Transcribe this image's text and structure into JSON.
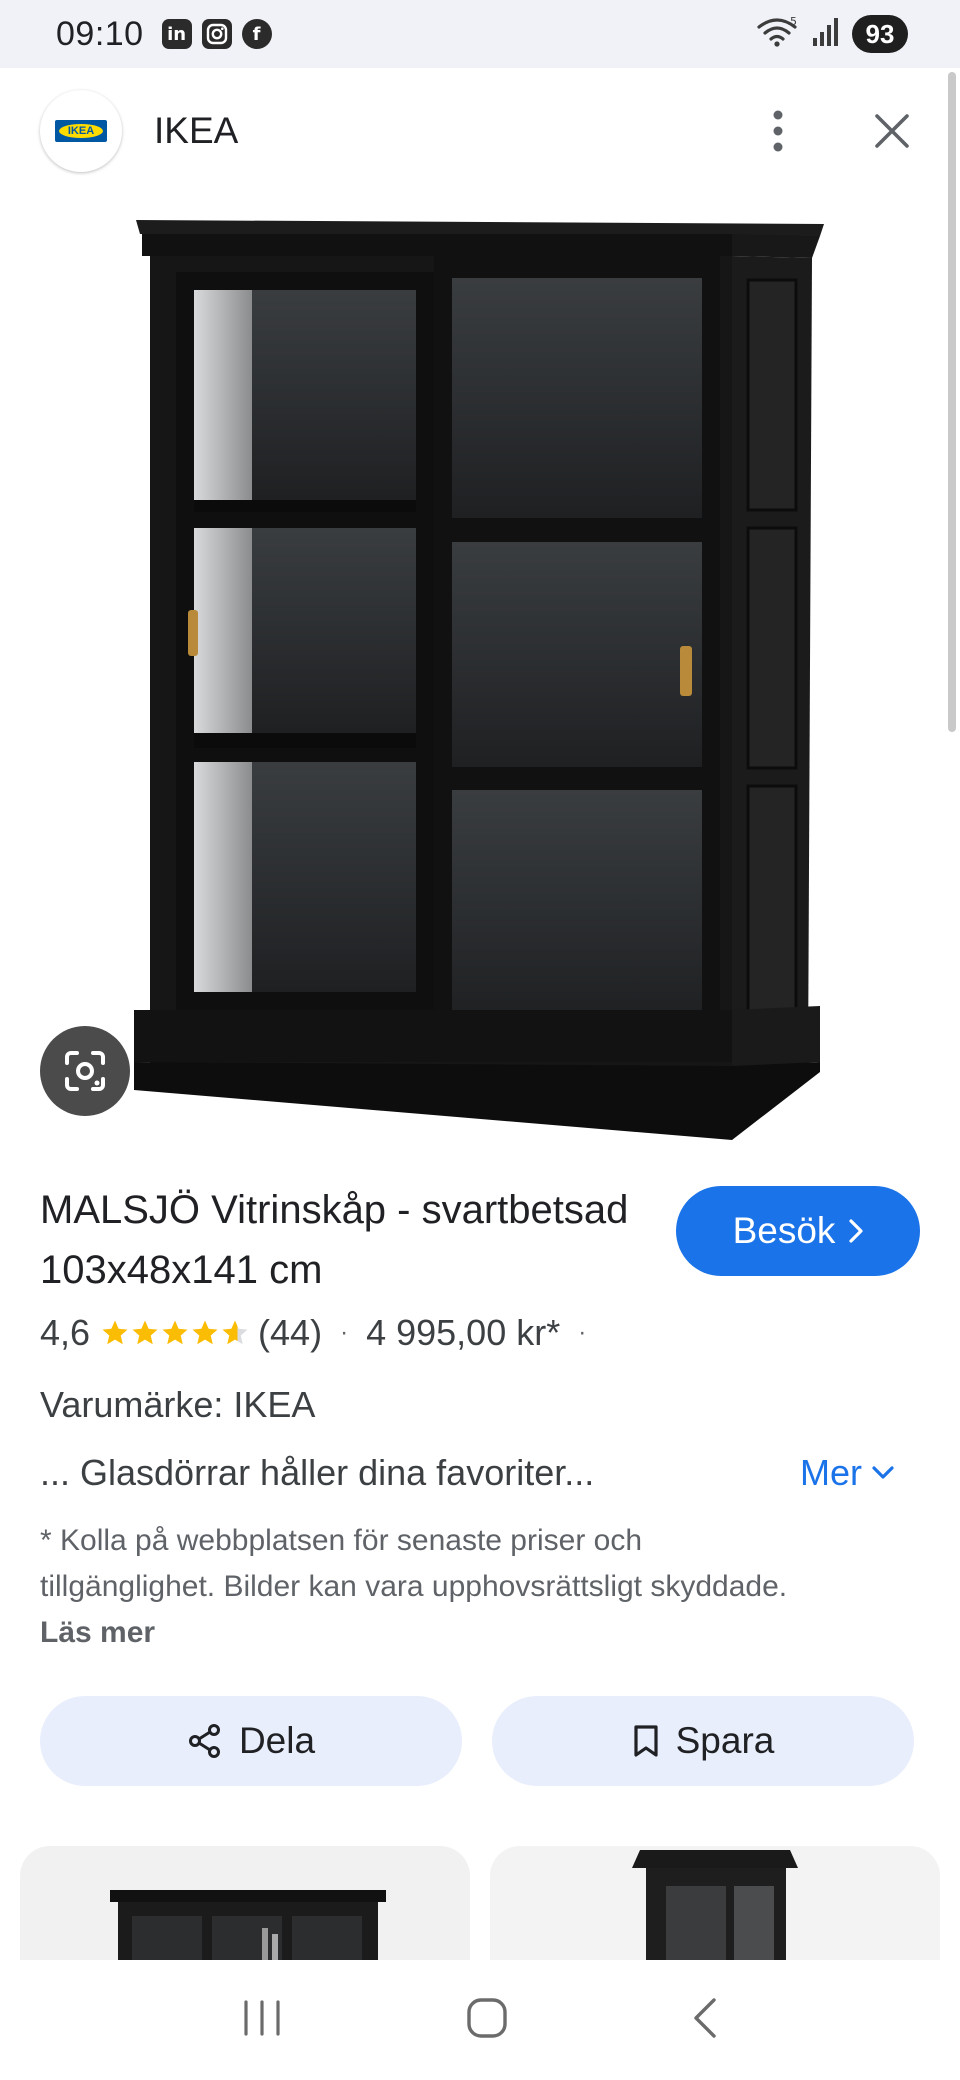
{
  "status_bar": {
    "time": "09:10",
    "apps": [
      "linkedin-icon",
      "instagram-icon",
      "facebook-icon"
    ],
    "wifi_badge": "5",
    "battery": "93"
  },
  "header": {
    "site_name": "IKEA",
    "logo_text": "IKEA"
  },
  "product": {
    "title": "MALSJÖ Vitrinskåp - svartbetsad 103x48x141 cm",
    "rating": "4,6",
    "rating_value": 4.6,
    "review_count": "(44)",
    "price": "4 995,00 kr*",
    "brand": "Varumärke: IKEA",
    "snippet": "... Glasdörrar håller dina favoriter...",
    "disclaimer": "* Kolla på webbplatsen för senaste priser och tillgänglighet. Bilder kan vara upphovsrättsligt skyddade.",
    "read_more": "Läs mer"
  },
  "actions": {
    "visit": "Besök",
    "more": "Mer",
    "share": "Dela",
    "save": "Spara"
  },
  "colors": {
    "accent": "#1a73e8",
    "star": "#fbbc04",
    "chip_bg": "#e8eefb"
  }
}
